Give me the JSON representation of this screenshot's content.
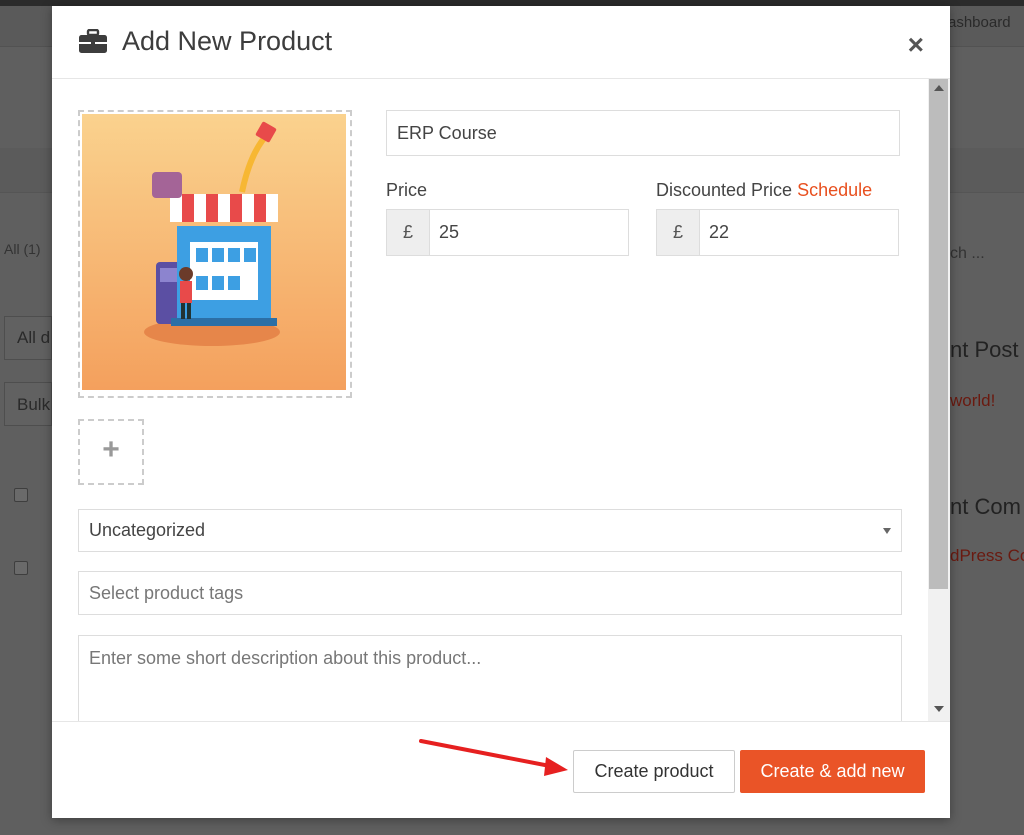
{
  "background": {
    "dashboard_link": "ashboard",
    "filter_all": "All (1)",
    "search_hint": "ch ...",
    "dropdown_all": "All d",
    "bulk": "Bulk",
    "recent_posts": "nt Post",
    "hello_world": "world!",
    "recent_comments": "nt Com",
    "wordpress_c": "dPress Co"
  },
  "modal": {
    "title": "Add New Product",
    "title_icon": "briefcase-icon",
    "close_icon": "close-icon",
    "close_label": "×",
    "product_name": "ERP Course",
    "price_label": "Price",
    "currency": "£",
    "price": "25",
    "discounted_label": "Discounted Price",
    "schedule_link": "Schedule",
    "discounted_price": "22",
    "add_image_label": "+",
    "category": "Uncategorized",
    "tags_placeholder": "Select product tags",
    "description_placeholder": "Enter some short description about this product..."
  },
  "footer": {
    "create_label": "Create product",
    "create_add_new_label": "Create & add new"
  },
  "colors": {
    "accent": "#ea5427",
    "link": "#e8501f"
  }
}
